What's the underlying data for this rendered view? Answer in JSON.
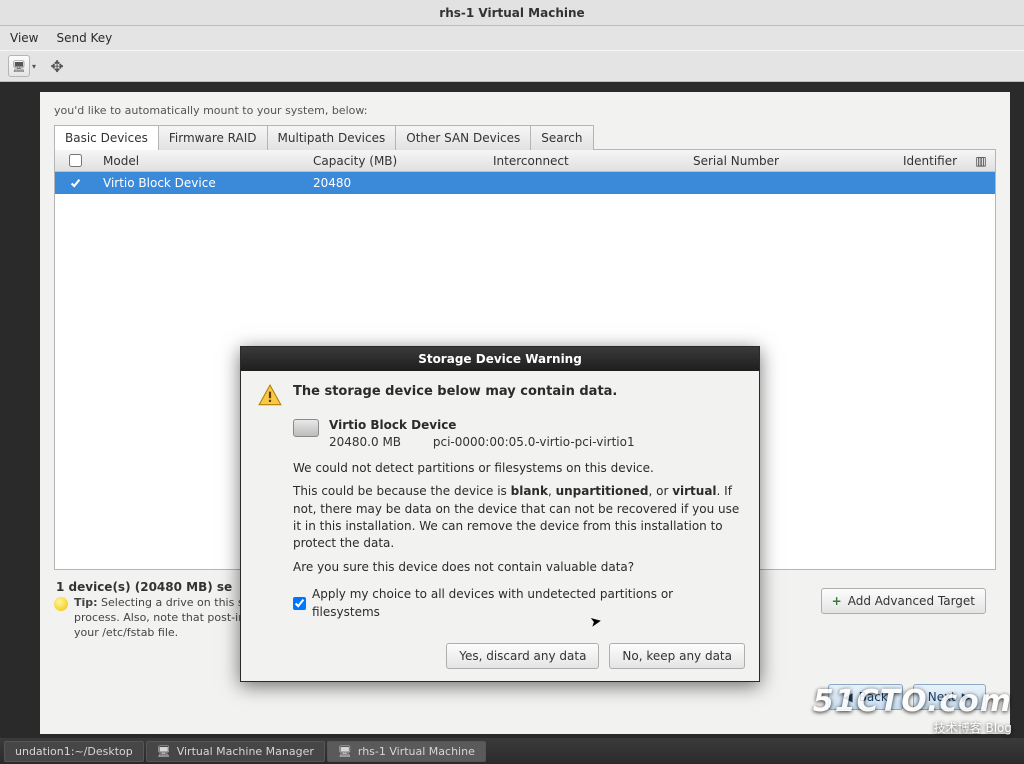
{
  "window": {
    "title": "rhs-1 Virtual Machine"
  },
  "menubar": {
    "view": "View",
    "sendkey": "Send Key"
  },
  "intro": "you'd like to automatically mount to your system, below:",
  "tabs": {
    "basic": "Basic Devices",
    "raid": "Firmware RAID",
    "multipath": "Multipath Devices",
    "othersan": "Other SAN Devices",
    "search": "Search"
  },
  "columns": {
    "model": "Model",
    "capacity": "Capacity (MB)",
    "interconnect": "Interconnect",
    "serial": "Serial Number",
    "identifier": "Identifier"
  },
  "row": {
    "model": "Virtio Block Device",
    "capacity": "20480",
    "interconnect": "",
    "serial": "",
    "identifier": ""
  },
  "summary": "1 device(s) (20480 MB) se",
  "tip": {
    "label": "Tip:",
    "text": "Selecting a drive on this screen does not necessarily mean it will be wiped by the installation process.  Also, note that post-installation you may mount drives you did not select here by modifying your /etc/fstab file."
  },
  "advanced_btn": "Add Advanced Target",
  "nav": {
    "back": "Back",
    "next": "Next"
  },
  "dialog": {
    "title": "Storage Device Warning",
    "heading": "The storage device below may contain data.",
    "device_name": "Virtio Block Device",
    "device_size": "20480.0 MB",
    "device_pci": "pci-0000:00:05.0-virtio-pci-virtio1",
    "p1": "We could not detect partitions or filesystems on this device.",
    "p2a": "This could be because the device is ",
    "p2b_blank": "blank",
    "p2c": ", ",
    "p2d_unpart": "unpartitioned",
    "p2e": ", or ",
    "p2f_virtual": "virtual",
    "p2g": ". If not, there may be data on the device that can not be recovered if you use it in this installation. We can remove the device from this installation to protect the data.",
    "p3": "Are you sure this device does not contain valuable data?",
    "apply": "Apply my choice to all devices with undetected partitions or filesystems",
    "yes": "Yes, discard any data",
    "no": "No, keep any data"
  },
  "taskbar": {
    "desktop": "undation1:~/Desktop",
    "vmm": "Virtual Machine Manager",
    "rhs": "rhs-1 Virtual Machine"
  },
  "watermark": {
    "big": "51CTO.com",
    "sm": "技术博客        Blog"
  }
}
